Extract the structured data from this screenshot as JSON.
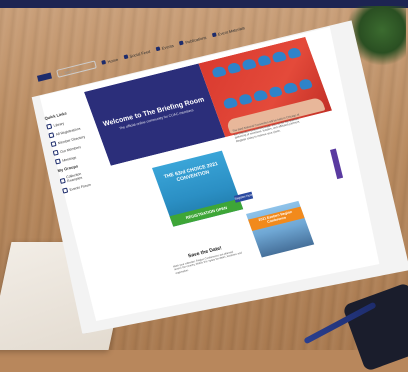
{
  "scene": {
    "accent": "#1d2452",
    "desk_color": "#b8875c"
  },
  "header": {
    "search_placeholder": "Search",
    "nav": [
      "Home",
      "Social Feed",
      "Events",
      "Publications",
      "Event Materials"
    ]
  },
  "sidebar": {
    "section_title": "Quick Links",
    "items": [
      "Library",
      "All Registrations",
      "Member Directory",
      "Our Members",
      "Meetings"
    ],
    "groups_title": "My Groups",
    "groups": [
      "Collection Examples",
      "Events Forum"
    ]
  },
  "hero": {
    "title": "Welcome to The Briefing Room",
    "subtitle": "The official online community for CUAC members",
    "left_color": "#2b2e7a",
    "right_color": "#d93a2f"
  },
  "event": {
    "title": "THE 63rd CHOICE 2021 CONVENTION",
    "cta": "REGISTRATION OPEN"
  },
  "blurb": {
    "text": "The 63rd National Convention will be held in Chicago at the Sheraton Grand Riverwalk. Join us for the premier gathering of members, leaders, and affiliated partners. Register today to reserve your place.",
    "button": "Register Now"
  },
  "city": {
    "badge": "2021 Eastern Region Conference"
  },
  "save_the_date": {
    "title": "Save the Date!",
    "text": "Mark your calendar: Region Conferences are planned across the country. Watch this space for dates, locations and registration."
  }
}
